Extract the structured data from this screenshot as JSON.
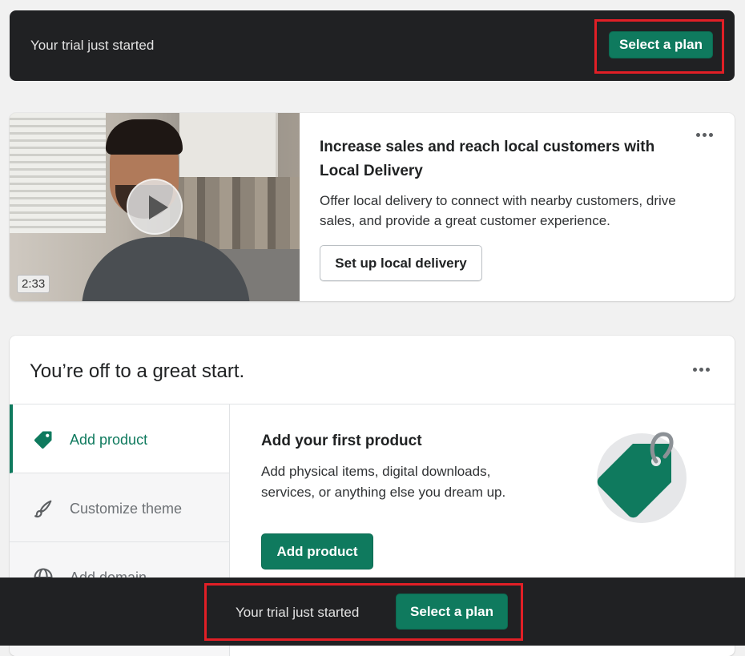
{
  "top_banner": {
    "text": "Your trial just started",
    "button_label": "Select a plan"
  },
  "delivery_card": {
    "video_duration": "2:33",
    "title": "Increase sales and reach local customers with Local Delivery",
    "description": "Offer local delivery to connect with nearby customers, drive sales, and provide a great customer experience.",
    "button_label": "Set up local delivery",
    "more_icon": "horizontal-dots-icon"
  },
  "start_card": {
    "title": "You’re off to a great start.",
    "more_icon": "horizontal-dots-icon",
    "steps": [
      {
        "label": "Add product",
        "icon": "tag-icon",
        "active": true
      },
      {
        "label": "Customize theme",
        "icon": "brush-icon",
        "active": false
      },
      {
        "label": "Add domain",
        "icon": "globe-icon",
        "active": false
      }
    ],
    "detail": {
      "title": "Add your first product",
      "description": "Add physical items, digital downloads, services, or anything else you dream up.",
      "button_label": "Add product"
    }
  },
  "bottom_bar": {
    "text": "Your trial just started",
    "button_label": "Select a plan"
  },
  "colors": {
    "accent": "#0f7a5e",
    "banner_bg": "#202123",
    "highlight": "#e11f26",
    "page_bg": "#f1f1f1"
  }
}
